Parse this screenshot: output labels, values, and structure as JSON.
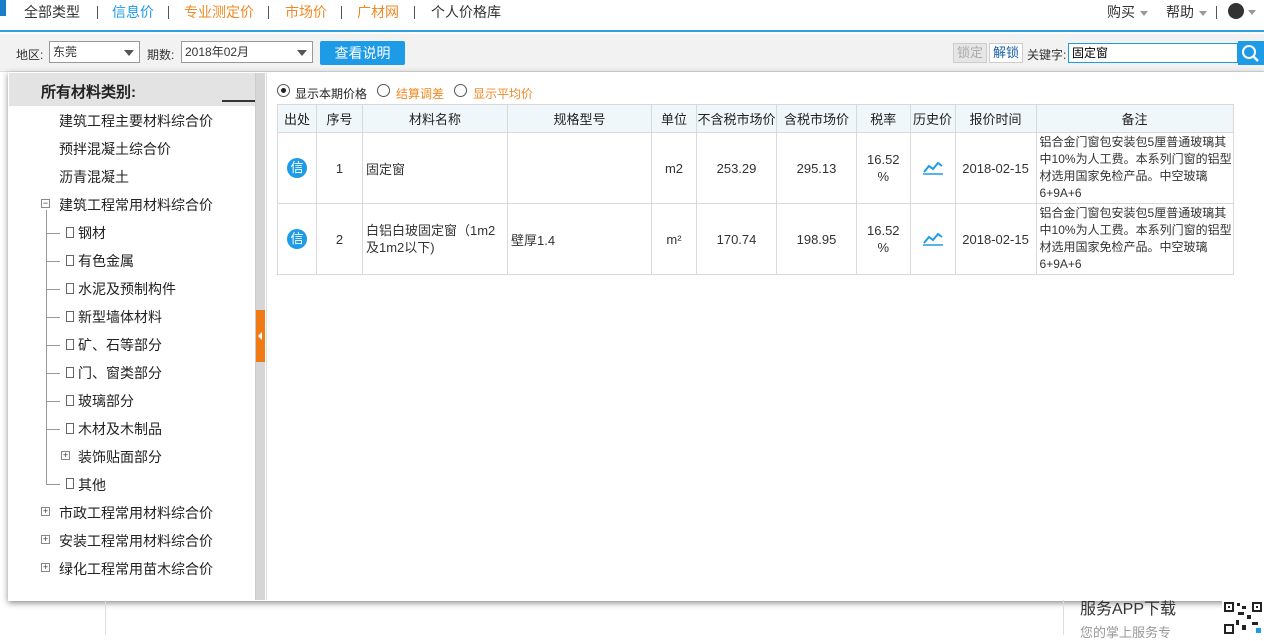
{
  "nav": {
    "items": [
      {
        "label": "全部类型",
        "color": "#333333"
      },
      {
        "label": "信息价",
        "color": "#1e9be6"
      },
      {
        "label": "专业测定价",
        "color": "#f08a24"
      },
      {
        "label": "市场价",
        "color": "#f08a24"
      },
      {
        "label": "广材网",
        "color": "#f08a24"
      },
      {
        "label": "个人价格库",
        "color": "#333333"
      }
    ],
    "buy_label": "购买",
    "help_label": "帮助"
  },
  "toolbar": {
    "region_label": "地区:",
    "region_value": "东莞",
    "period_label": "期数:",
    "period_value": "2018年02月",
    "explain_button": "查看说明",
    "lock_button": "锁定",
    "unlock_button": "解锁",
    "keyword_label": "关键字:",
    "keyword_value": "固定窗"
  },
  "sidebar": {
    "header": "所有材料类别:",
    "top_items": [
      "建筑工程主要材料综合价",
      "预拌混凝土综合价",
      "沥青混凝土"
    ],
    "group_label": "建筑工程常用材料综合价",
    "children": [
      "钢材",
      "有色金属",
      "水泥及预制构件",
      "新型墙体材料",
      "矿、石等部分",
      "门、窗类部分",
      "玻璃部分",
      "木材及木制品",
      "装饰贴面部分",
      "其他"
    ],
    "bottom_items": [
      "市政工程常用材料综合价",
      "安装工程常用材料综合价",
      "绿化工程常用苗木综合价"
    ]
  },
  "options": {
    "show_current": "显示本期价格",
    "settle_diff": "结算调差",
    "show_avg": "显示平均价"
  },
  "table": {
    "headers": [
      "出处",
      "序号",
      "材料名称",
      "规格型号",
      "单位",
      "不含税市场价",
      "含税市场价",
      "税率",
      "历史价",
      "报价时间",
      "备注"
    ],
    "rows": [
      {
        "source": "信",
        "index": "1",
        "name": "固定窗",
        "spec": "",
        "unit": "m2",
        "price_ex_tax": "253.29",
        "price_in_tax": "295.13",
        "tax_rate": "16.52 %",
        "date": "2018-02-15",
        "remark": "铝合金门窗包安装包5厘普通玻璃其中10%为人工费。本系列门窗的铝型材选用国家免检产品。中空玻璃6+9A+6"
      },
      {
        "source": "信",
        "index": "2",
        "name": "白铝白玻固定窗（1m2及1m2以下)",
        "spec": "壁厚1.4",
        "unit": "m²",
        "price_ex_tax": "170.74",
        "price_in_tax": "198.95",
        "tax_rate": "16.52 %",
        "date": "2018-02-15",
        "remark": "铝合金门窗包安装包5厘普通玻璃其中10%为人工费。本系列门窗的铝型材选用国家免检产品。中空玻璃6+9A+6"
      }
    ]
  },
  "background": {
    "app_download": "服务APP下载",
    "app_sub": "您的掌上服务专"
  },
  "colors": {
    "accent": "#1e9be6",
    "orange": "#f08a24"
  }
}
